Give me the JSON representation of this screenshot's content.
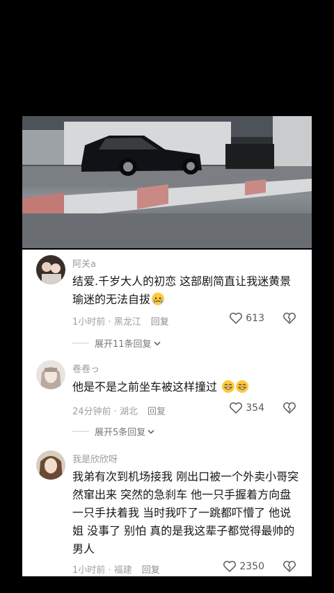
{
  "comments": [
    {
      "username": "阿关a",
      "text": "结爱.千岁大人的初恋 这部剧简直让我迷黄景瑜迷的无法自拔",
      "time": "1小时前",
      "location": "黑龙江",
      "reply": "回复",
      "likes": "613",
      "expand": "展开11条回复",
      "emoji": "crying-face"
    },
    {
      "username": "卷卷っ",
      "text": "他是不是之前坐车被这样撞过",
      "time": "24分钟前",
      "location": "湖北",
      "reply": "回复",
      "likes": "354",
      "expand": "展开5条回复",
      "emoji": "grinning-face"
    },
    {
      "username": "我是欣欣呀",
      "text": "我弟有次到机场接我 刚出口被一个外卖小哥突然窜出来 突然的急刹车 他一只手握着方向盘 一只手扶着我 当时我吓了一跳都吓懵了 他说 姐 没事了 别怕 真的是我这辈子都觉得最帅的男人",
      "time": "1小时前",
      "location": "福建",
      "reply": "回复",
      "likes": "2350"
    }
  ],
  "colors": {
    "background": "#000000",
    "panel": "#ffffff",
    "text": "#161616",
    "meta": "#a0a0a0"
  }
}
